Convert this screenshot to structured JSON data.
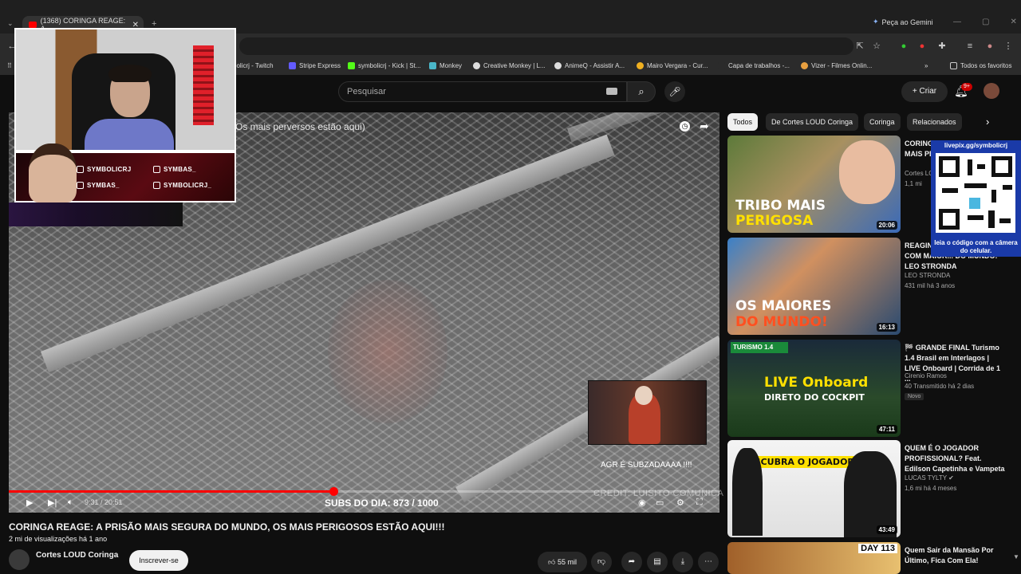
{
  "browser": {
    "tab_title": "(1368) CORINGA REAGE: A",
    "gemini": "Peça ao Gemini",
    "bookmarks": [
      {
        "label": "bolicrj - Twitch",
        "color": "#9146ff"
      },
      {
        "label": "Stripe Express",
        "color": "#635bff"
      },
      {
        "label": "symbolicrj - Kick | St...",
        "color": "#53fc18"
      },
      {
        "label": "Monkey",
        "color": "#4ab7c9"
      },
      {
        "label": "Creative Monkey | L...",
        "color": "#dddddd"
      },
      {
        "label": "AnimeQ - Assistir A...",
        "color": "#dddddd"
      },
      {
        "label": "Mairo Vergara - Cur...",
        "color": "#f0b020"
      },
      {
        "label": "Capa de trabalhos -...",
        "color": "#2b2b2b"
      },
      {
        "label": "Vizer - Filmes Onlin...",
        "color": "#e8a040"
      }
    ],
    "all_bookmarks": "Todos os favoritos"
  },
  "header": {
    "search_placeholder": "Pesquisar",
    "create_label": "Criar",
    "notif_count": "9+"
  },
  "player": {
    "overlay_title": "(Os mais perversos estão aqui)",
    "inset_caption": "AGR É SUBZADAAAA !!!!",
    "credit": "CREDIT: LUISITO COMUNICA",
    "time": "9:31 / 20:51",
    "progress": 0.4566,
    "subs_counter": "SUBS DO DIA: 873 / 1000"
  },
  "streamer": {
    "twitch": "SYMBOLICRJ",
    "tiktok": "SYMBAS_",
    "youtube": "SYMBAS_",
    "instagram": "SYMBOLICRJ_"
  },
  "video": {
    "title": "CORINGA REAGE: A PRISÃO MAIS SEGURA DO MUNDO, OS MAIS PERIGOSOS ESTÃO AQUI!!!",
    "views": "2 mi de visualizações  há 1 ano",
    "channel": "Cortes LOUD Coringa",
    "subscribe": "Inscrever-se",
    "likes": "55 mil"
  },
  "chips": [
    "Todos",
    "De Cortes LOUD Coringa",
    "Coringa",
    "Relacionados"
  ],
  "recommendations": [
    {
      "title": "CORINGA REAGE: A TRIBO MAIS PERIGOSA DO MUNDO",
      "channel": "Cortes LOUD Coringa",
      "meta": "1,1 mi",
      "duration": "20:06",
      "thumb_text_1": "TRIBO MAIS",
      "thumb_text_2": "PERIGOSA"
    },
    {
      "title": "REAGINDO AS PESSOAS COM MAIOR... DO MUNDO! - LEO STRONDA",
      "channel": "LEO STRONDA",
      "meta": "431 mil  há 3 anos",
      "duration": "16:13",
      "thumb_text_1": "OS MAIORES",
      "thumb_text_2": "DO MUNDO!"
    },
    {
      "title": "🏁 GRANDE FINAL Turismo 1.4 Brasil em Interlagos | LIVE Onboard | Corrida de 1 ...",
      "channel": "Cirenio Ramos",
      "meta": "40  Transmitido há 2 dias",
      "duration": "47:11",
      "badge": "Novo",
      "thumb_text_1": "LIVE Onboard",
      "thumb_text_2": "DIRETO DO COCKPIT"
    },
    {
      "title": "QUEM É O JOGADOR PROFISSIONAL? Feat. Edilson Capetinha e Vampeta",
      "channel": "LUCAS TYLTY",
      "meta": "1,6 mi  há 4 meses",
      "duration": "43:49",
      "thumb_text_1": "DESCUBRA O JOGADOR",
      "thumb_text_2": ""
    },
    {
      "title": "Quem Sair da Mansão Por Último, Fica Com Ela!",
      "channel": "",
      "meta": "",
      "duration": "",
      "thumb_text_1": "DAY 113",
      "thumb_text_2": ""
    }
  ],
  "qr_overlay": {
    "url": "livepix.gg/symbolicrj",
    "hint": "leia o código com a câmera do celular."
  }
}
